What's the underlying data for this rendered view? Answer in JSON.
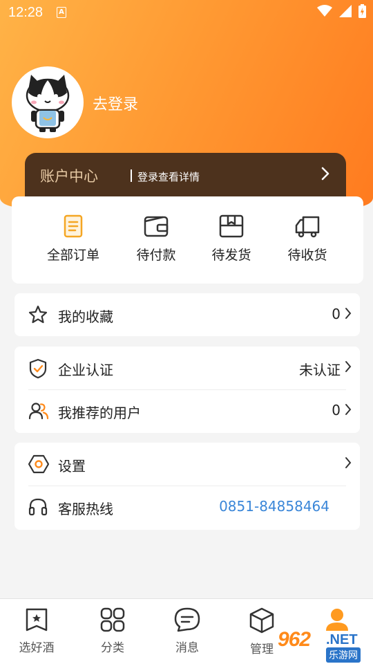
{
  "status_bar": {
    "time": "12:28",
    "a_glyph": "A"
  },
  "profile": {
    "login_text": "去登录"
  },
  "account": {
    "title": "账户中心",
    "subtitle": "登录查看详情"
  },
  "orders": [
    {
      "label": "全部订单",
      "icon": "document-icon"
    },
    {
      "label": "待付款",
      "icon": "wallet-icon"
    },
    {
      "label": "待发货",
      "icon": "box-icon"
    },
    {
      "label": "待收货",
      "icon": "truck-icon"
    }
  ],
  "favorites": {
    "label": "我的收藏",
    "value": "0"
  },
  "enterprise": {
    "label": "企业认证",
    "value": "未认证"
  },
  "referrals": {
    "label": "我推荐的用户",
    "value": "0"
  },
  "settings": {
    "label": "设置"
  },
  "hotline": {
    "label": "客服热线",
    "value": "0851-84858464"
  },
  "tabs": [
    {
      "label": "选好酒",
      "icon": "wine-badge-icon"
    },
    {
      "label": "分类",
      "icon": "grid-icon"
    },
    {
      "label": "消息",
      "icon": "chat-icon"
    },
    {
      "label": "管理",
      "icon": "cube-icon"
    },
    {
      "label": "",
      "icon": "user-icon"
    }
  ],
  "watermark": {
    "number": "962",
    "net": ".NET",
    "site": "乐游网"
  },
  "colors": {
    "accent": "#ff9a33",
    "account_bg": "#4d321d",
    "phone": "#3a86d8"
  }
}
